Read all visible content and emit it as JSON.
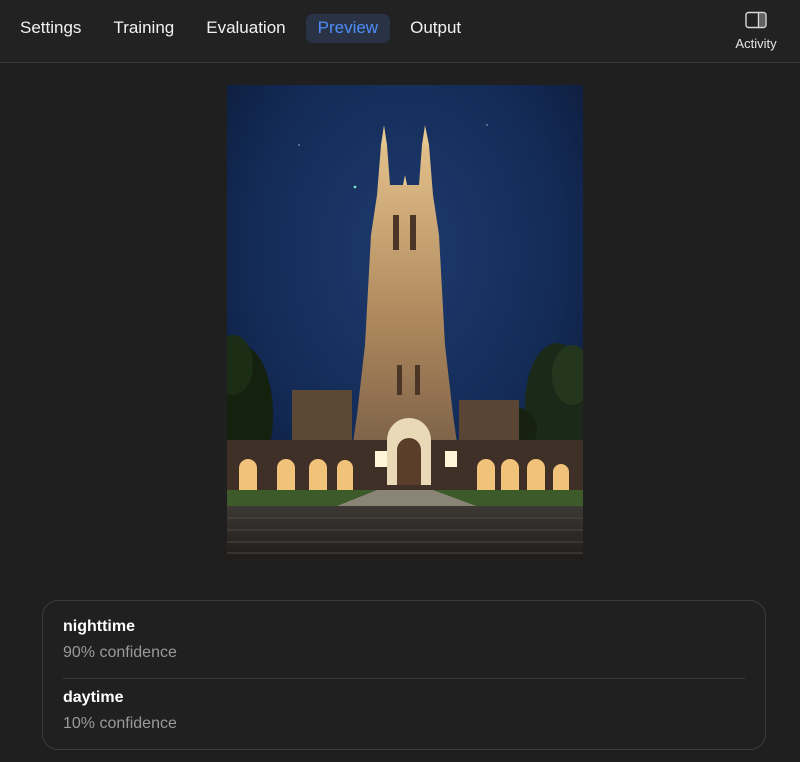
{
  "tabs": [
    {
      "label": "Settings",
      "active": false
    },
    {
      "label": "Training",
      "active": false
    },
    {
      "label": "Evaluation",
      "active": false
    },
    {
      "label": "Preview",
      "active": true
    },
    {
      "label": "Output",
      "active": false
    }
  ],
  "activity": {
    "label": "Activity",
    "icon": "sidebar-panel-icon"
  },
  "preview": {
    "image": "duke-chapel-night-photo"
  },
  "results": [
    {
      "label": "nighttime",
      "confidence": "90% confidence"
    },
    {
      "label": "daytime",
      "confidence": "10% confidence"
    }
  ],
  "colors": {
    "background": "#1f1f1f",
    "accent": "#4d8ef7",
    "active_tab_bg": "#2a3346",
    "secondary_text": "#9a9a9a"
  }
}
